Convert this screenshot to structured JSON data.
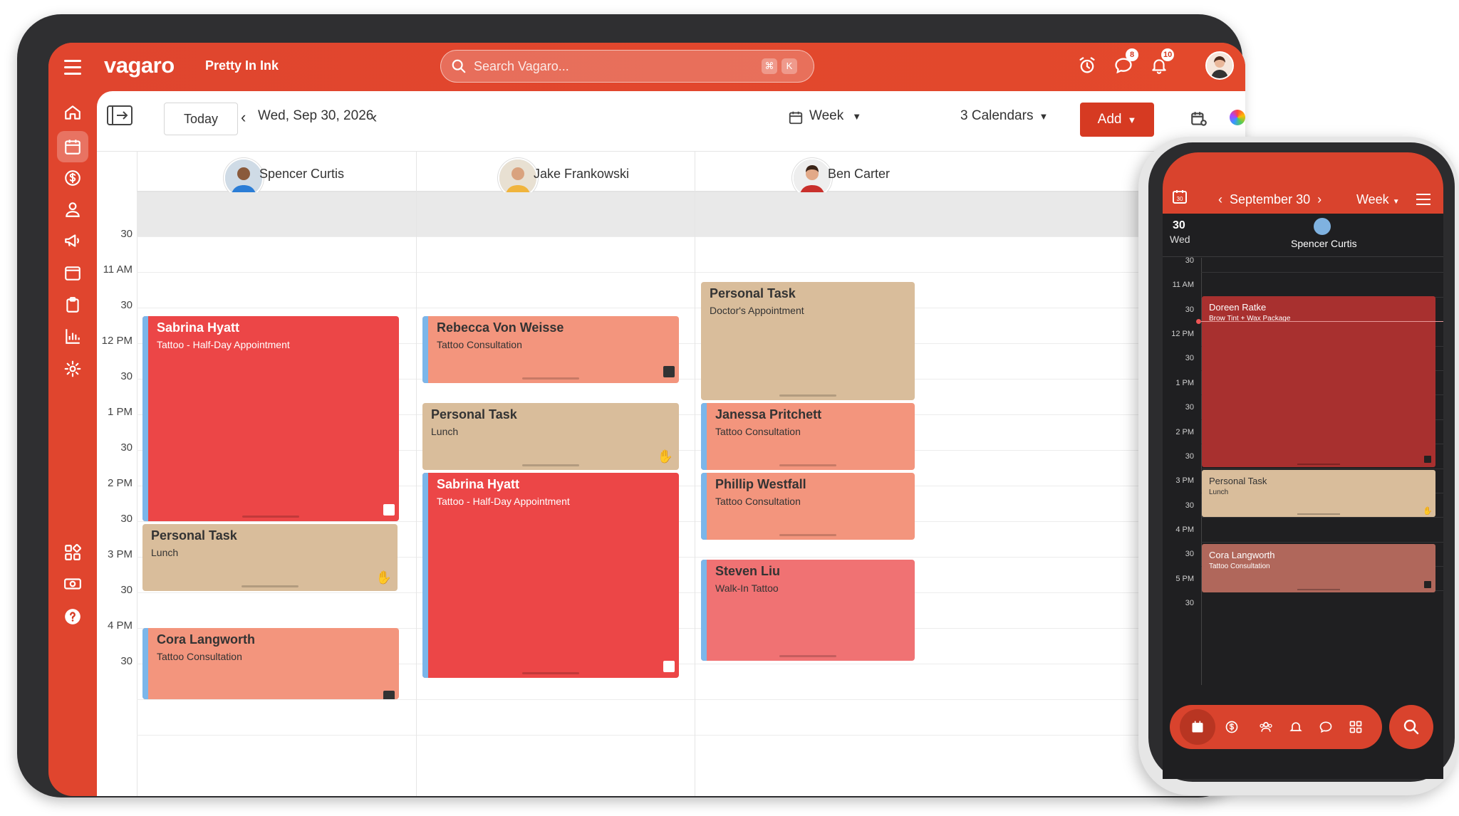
{
  "app": {
    "logo": "vagaro",
    "business": "Pretty In Ink"
  },
  "search": {
    "placeholder": "Search Vagaro...",
    "key1": "⌘",
    "key2": "K"
  },
  "badges": {
    "messages": "8",
    "notifications": "10"
  },
  "toolbar": {
    "today": "Today",
    "date": "Wed, Sep 30, 2026",
    "view": "Week",
    "calendars": "3 Calendars",
    "add": "Add"
  },
  "times": [
    "30",
    "11 AM",
    "30",
    "12 PM",
    "30",
    "1 PM",
    "30",
    "2 PM",
    "30",
    "3 PM",
    "30",
    "4 PM",
    "30"
  ],
  "staff": [
    {
      "name": "Spencer Curtis"
    },
    {
      "name": "Jake Frankowski"
    },
    {
      "name": "Ben Carter"
    }
  ],
  "appointments": {
    "spencer": [
      {
        "client": "Sabrina Hyatt",
        "service": "Tattoo - Half-Day Appointment"
      },
      {
        "client": "Personal Task",
        "service": "Lunch"
      },
      {
        "client": "Cora Langworth",
        "service": "Tattoo Consultation"
      }
    ],
    "jake": [
      {
        "client": "Rebecca Von Weisse",
        "service": "Tattoo Consultation"
      },
      {
        "client": "Personal Task",
        "service": "Lunch"
      },
      {
        "client": "Sabrina Hyatt",
        "service": "Tattoo - Half-Day Appointment"
      }
    ],
    "ben": [
      {
        "client": "Personal Task",
        "service": "Doctor's Appointment"
      },
      {
        "client": "Janessa Pritchett",
        "service": "Tattoo Consultation"
      },
      {
        "client": "Phillip Westfall",
        "service": "Tattoo Consultation"
      },
      {
        "client": "Steven Liu",
        "service": "Walk-In Tattoo"
      }
    ]
  },
  "colors": {
    "brand": "#E0452E",
    "appointment_red": "#EC4647",
    "consultation": "#F3957D",
    "personal_task": "#D9BD9B",
    "walk_in": "#F07273",
    "staff_bar": "#7BB6EA"
  },
  "phone": {
    "cal_icon_num": "30",
    "date": "September 30",
    "view": "Week",
    "day_num": "30",
    "day_name": "Wed",
    "staff": "Spencer Curtis",
    "times": [
      "30",
      "11 AM",
      "30",
      "12 PM",
      "30",
      "1 PM",
      "30",
      "2 PM",
      "30",
      "3 PM",
      "30",
      "4 PM",
      "30",
      "5 PM",
      "30"
    ],
    "appointments": [
      {
        "client": "Doreen Ratke",
        "service": "Brow Tint + Wax Package"
      },
      {
        "client": "Personal Task",
        "service": "Lunch"
      },
      {
        "client": "Cora Langworth",
        "service": "Tattoo Consultation"
      }
    ],
    "nav_icons": [
      "calendar-icon",
      "dollar-icon",
      "clients-icon",
      "bell-icon",
      "chat-icon",
      "apps-icon"
    ]
  },
  "sidebar_icons": [
    "home-icon",
    "calendar-icon",
    "dollar-icon",
    "user-icon",
    "megaphone-icon",
    "browser-icon",
    "clipboard-icon",
    "chart-icon",
    "gear-icon",
    "apps-icon",
    "money-icon",
    "help-icon"
  ]
}
